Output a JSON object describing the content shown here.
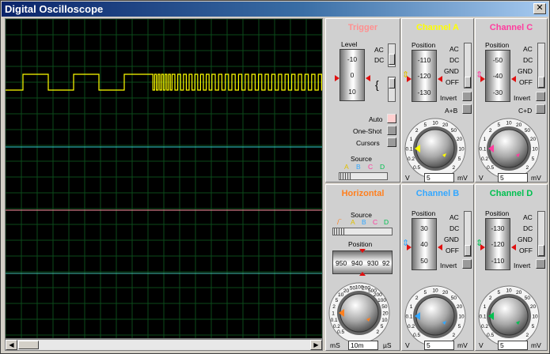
{
  "window": {
    "title": "Digital Oscilloscope",
    "close_label": "✕"
  },
  "scrollbar": {
    "left_arrow": "◀",
    "right_arrow": "▶"
  },
  "trigger": {
    "title": "Trigger",
    "level_label": "Level",
    "drum": [
      "-10",
      "0",
      "10"
    ],
    "ac": "AC",
    "dc": "DC",
    "auto": "Auto",
    "one_shot": "One-Shot",
    "cursors": "Cursors",
    "source_label": "Source",
    "sources": [
      "A",
      "B",
      "C",
      "D"
    ]
  },
  "channel_a": {
    "title": "Channel A",
    "position_label": "Position",
    "drum": [
      "-110",
      "-120",
      "-130"
    ],
    "ac": "AC",
    "dc": "DC",
    "gnd": "GND",
    "off": "OFF",
    "invert": "Invert",
    "extra": "A+B",
    "knob_ticks": [
      "0.5",
      "0.2",
      "0.1",
      "1",
      "2",
      "5",
      "10",
      "20",
      "50",
      "20",
      "10",
      "5",
      "2"
    ],
    "unit_left": "V",
    "value": "5",
    "unit_right": "mV"
  },
  "channel_c": {
    "title": "Channel C",
    "position_label": "Position",
    "drum": [
      "-50",
      "-40",
      "-30"
    ],
    "ac": "AC",
    "dc": "DC",
    "gnd": "GND",
    "off": "OFF",
    "invert": "Invert",
    "extra": "C+D",
    "knob_ticks": [
      "0.5",
      "0.2",
      "0.1",
      "1",
      "2",
      "5",
      "10",
      "20",
      "50",
      "20",
      "10",
      "5",
      "2"
    ],
    "unit_left": "V",
    "value": "5",
    "unit_right": "mV"
  },
  "horizontal": {
    "title": "Horizontal",
    "source_label": "Source",
    "sources": [
      "A",
      "B",
      "C",
      "D"
    ],
    "position_label": "Position",
    "drum": [
      "950",
      "940",
      "930",
      "92"
    ],
    "knob_ticks": [
      "0.5",
      "0.2",
      "0.1",
      "1",
      "2",
      "5",
      "10",
      "20",
      "50",
      "100",
      "200",
      "500",
      "200",
      "100",
      "50",
      "20",
      "10",
      "5",
      "2"
    ],
    "unit_left": "mS",
    "value": "10m",
    "unit_right": "µS"
  },
  "channel_b": {
    "title": "Channel B",
    "position_label": "Position",
    "drum": [
      "30",
      "40",
      "50"
    ],
    "ac": "AC",
    "dc": "DC",
    "gnd": "GND",
    "off": "OFF",
    "invert": "Invert",
    "knob_ticks": [
      "0.5",
      "0.2",
      "0.1",
      "1",
      "2",
      "5",
      "10",
      "20",
      "50",
      "20",
      "10",
      "5",
      "2"
    ],
    "unit_left": "V",
    "value": "5",
    "unit_right": "mV"
  },
  "channel_d": {
    "title": "Channel D",
    "position_label": "Position",
    "drum": [
      "-130",
      "-120",
      "-110"
    ],
    "ac": "AC",
    "dc": "DC",
    "gnd": "GND",
    "off": "OFF",
    "invert": "Invert",
    "knob_ticks": [
      "0.5",
      "0.2",
      "0.1",
      "1",
      "2",
      "5",
      "10",
      "20",
      "50",
      "20",
      "10",
      "5",
      "2"
    ],
    "unit_left": "V",
    "value": "5",
    "unit_right": "mV"
  },
  "colors": {
    "trigger_title": "#ff9090",
    "channel_a": "#ffff00",
    "channel_b": "#33a7ff",
    "channel_c": "#ff3c9e",
    "channel_d": "#00c050",
    "horizontal": "#ff7f1e",
    "grid": "#0b4a1a",
    "trace_b": "#2fd0d0",
    "trace_c": "#ff8fa0",
    "trace_d": "#40c0b0"
  }
}
